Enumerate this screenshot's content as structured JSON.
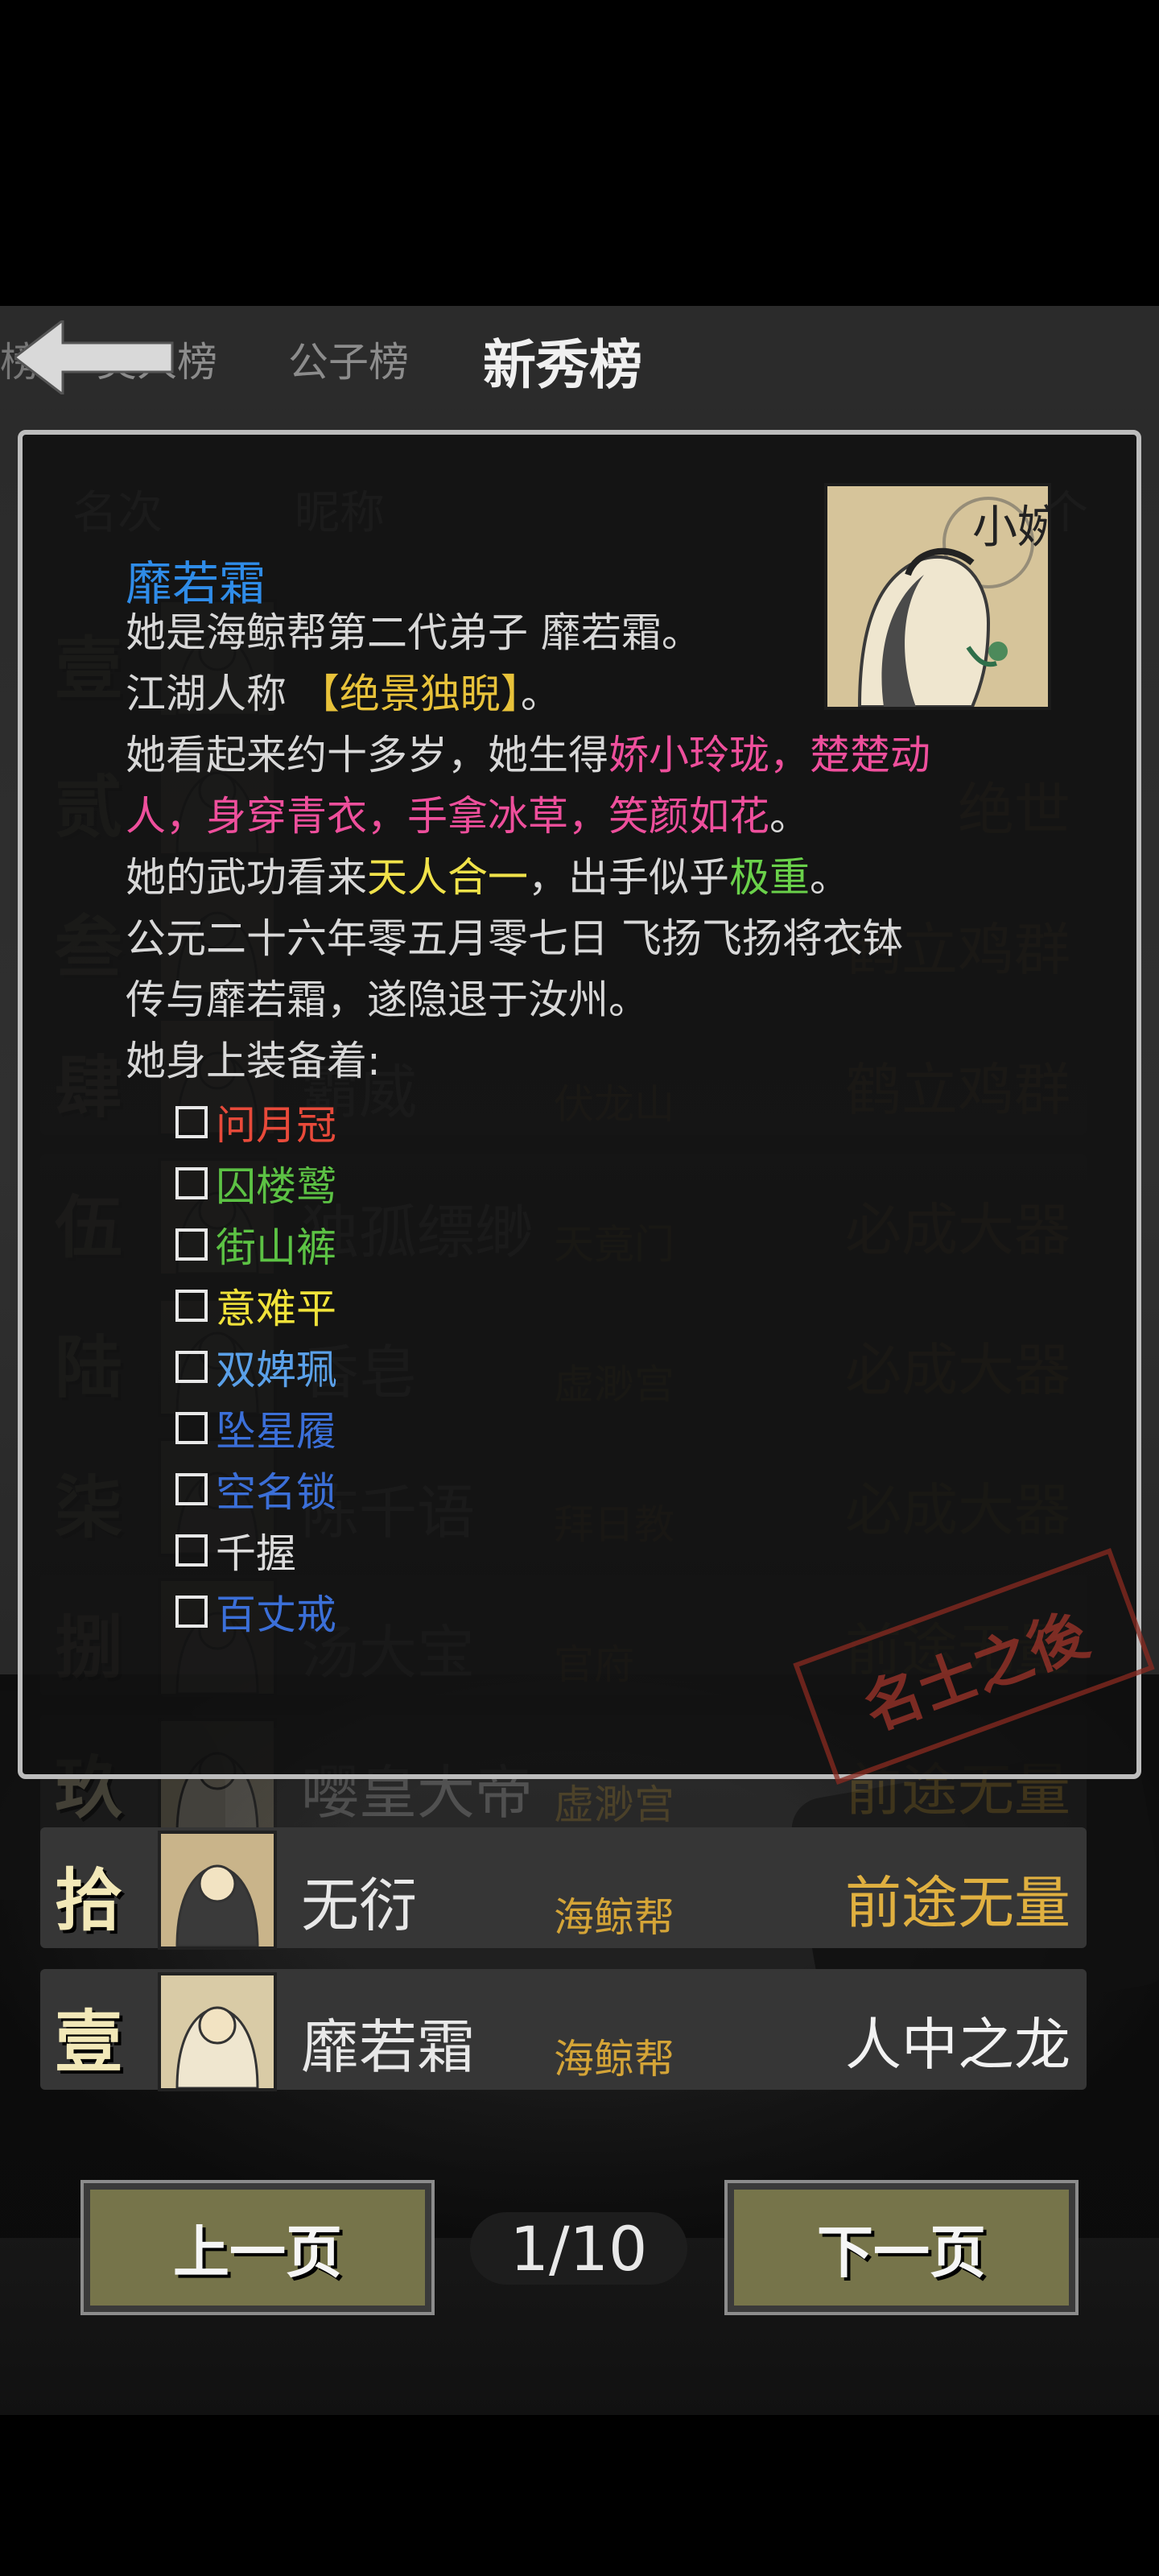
{
  "tabs": {
    "partial_left": "榜",
    "meiren": "美人榜",
    "gongzi": "公子榜",
    "xinxiu": "新秀榜"
  },
  "list": {
    "header": {
      "rank": "名次",
      "nick": "昵称",
      "right": "个"
    },
    "rows": [
      {
        "rank": "壹",
        "name": "",
        "sect": "",
        "title": ""
      },
      {
        "rank": "贰",
        "name": "",
        "sect": "",
        "title": "绝世"
      },
      {
        "rank": "叁",
        "name": "",
        "sect": "",
        "title": "鹤立鸡群"
      },
      {
        "rank": "肆",
        "name": "霸威",
        "sect": "伏龙山",
        "title": "鹤立鸡群"
      },
      {
        "rank": "伍",
        "name": "独孤缥缈",
        "sect": "天竟门",
        "title": "必成大器"
      },
      {
        "rank": "陆",
        "name": "香皂",
        "sect": "虚渺宫",
        "title": "必成大器"
      },
      {
        "rank": "柒",
        "name": "陈千语",
        "sect": "拜日教",
        "title": "必成大器"
      },
      {
        "rank": "捌",
        "name": "汤大宝",
        "sect": "官府",
        "title": "前途无量"
      },
      {
        "rank": "玖",
        "name": "嘤皇大帝",
        "sect": "虚渺宫",
        "title": "前途无量"
      },
      {
        "rank": "拾",
        "name": "无衍",
        "sect": "海鲸帮",
        "title": "前途无量"
      },
      {
        "rank": "壹",
        "name": "靡若霜",
        "sect": "海鲸帮",
        "title": "人中之龙"
      }
    ]
  },
  "stamp": "名士之後",
  "popup": {
    "name": "靡若霜",
    "portrait_text": "小婉",
    "line1": "她是海鲸帮第二代弟子 靡若霜。",
    "line2_a": "江湖人称 ",
    "line2_b": "【绝景独睨】",
    "line2_c": "。",
    "line3_a": "她看起来约十多岁，她生得",
    "line3_b": "娇小玲珑，楚楚动",
    "line4_a": "人，身穿青衣，手拿冰草，笑颜如花",
    "line4_b": "。",
    "line5_a": "她的武功看来",
    "line5_b": "天人合一",
    "line5_c": "，出手似乎",
    "line5_d": "极重",
    "line5_e": "。",
    "line6": "公元二十六年零五月零七日 飞扬飞扬将衣钵",
    "line7": "传与靡若霜，遂隐退于汝州。",
    "line8": "她身上装备着:",
    "equipment": [
      {
        "name": "问月冠",
        "color": "#e84a3a"
      },
      {
        "name": "囚楼鹫",
        "color": "#5cc244"
      },
      {
        "name": "街山裤",
        "color": "#5cc244"
      },
      {
        "name": "意难平",
        "color": "#f0e23a"
      },
      {
        "name": "双婢珮",
        "color": "#5aa0e8"
      },
      {
        "name": "坠星履",
        "color": "#3b6fd8"
      },
      {
        "name": "空名锁",
        "color": "#3b6fd8"
      },
      {
        "name": "千握",
        "color": "#dcdcdc"
      },
      {
        "name": "百丈戒",
        "color": "#3b6fd8"
      }
    ]
  },
  "pager": {
    "prev": "上一页",
    "indicator": "1/10",
    "next": "下一页"
  }
}
